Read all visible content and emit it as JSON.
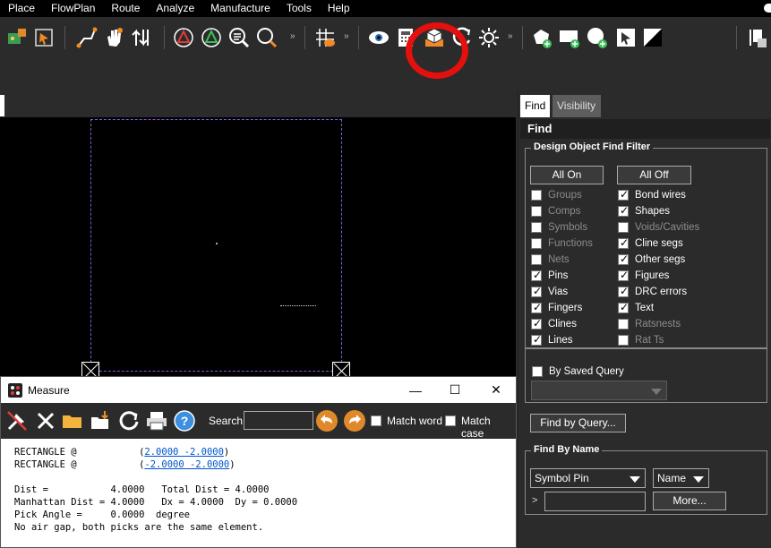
{
  "menu": [
    "Place",
    "FlowPlan",
    "Route",
    "Analyze",
    "Manufacture",
    "Tools",
    "Help"
  ],
  "toolbar": {
    "icons": [
      "component-chip-icon",
      "select-chip-icon",
      "route-icon",
      "hand-move-icon",
      "swap-icon",
      "drc-red-icon",
      "drc-green-icon",
      "zoom-list-icon",
      "zoom-icon",
      "grid-eye-icon",
      "eye-icon",
      "calculator-icon",
      "3d-box-icon",
      "sync-icon",
      "light-icon",
      "shape-add-icon",
      "rect-add-icon",
      "circle-add-icon",
      "select-arrow-icon",
      "contrast-icon",
      "pin-settings-icon"
    ],
    "highlight_color": "#e3100e"
  },
  "measure": {
    "title": "Measure",
    "minimize": "—",
    "maximize": "☐",
    "close": "✕",
    "search_label": "Search:",
    "search_value": "",
    "match_word": "Match word",
    "match_case": "Match case",
    "output": {
      "line1_prefix": "RECTANGLE @           (",
      "line1_link": "2.0000 -2.0000",
      "line1_suffix": ")",
      "line2_prefix": "RECTANGLE @           (",
      "line2_link": "-2.0000 -2.0000",
      "line2_suffix": ")",
      "line3": "Dist =           4.0000   Total Dist = 4.0000",
      "line4": "Manhattan Dist = 4.0000   Dx = 4.0000  Dy = 0.0000",
      "line5": "Pick Angle =     0.0000  degree",
      "line6": "No air gap, both picks are the same element."
    }
  },
  "panel": {
    "tab_find": "Find",
    "tab_visibility": "Visibility",
    "header": "Find",
    "filter_title": "Design Object Find Filter",
    "all_on": "All On",
    "all_off": "All Off",
    "left_items": [
      {
        "label": "Groups",
        "checked": false
      },
      {
        "label": "Comps",
        "checked": false
      },
      {
        "label": "Symbols",
        "checked": false
      },
      {
        "label": "Functions",
        "checked": false
      },
      {
        "label": "Nets",
        "checked": false
      },
      {
        "label": "Pins",
        "checked": true
      },
      {
        "label": "Vias",
        "checked": true
      },
      {
        "label": "Fingers",
        "checked": true
      },
      {
        "label": "Clines",
        "checked": true
      },
      {
        "label": "Lines",
        "checked": true
      }
    ],
    "right_items": [
      {
        "label": "Bond wires",
        "checked": true
      },
      {
        "label": "Shapes",
        "checked": true
      },
      {
        "label": "Voids/Cavities",
        "checked": false
      },
      {
        "label": "Cline segs",
        "checked": true
      },
      {
        "label": "Other segs",
        "checked": true
      },
      {
        "label": "Figures",
        "checked": true
      },
      {
        "label": "DRC errors",
        "checked": true
      },
      {
        "label": "Text",
        "checked": true
      },
      {
        "label": "Ratsnests",
        "checked": false
      },
      {
        "label": "Rat Ts",
        "checked": false
      }
    ],
    "saved_query_label": "By Saved Query",
    "saved_query_value": "",
    "find_by_query": "Find by Query...",
    "find_by_name_title": "Find By Name",
    "name_type": "Symbol Pin",
    "name_mode": "Name",
    "name_prefix": ">",
    "name_value": "",
    "more": "More..."
  }
}
